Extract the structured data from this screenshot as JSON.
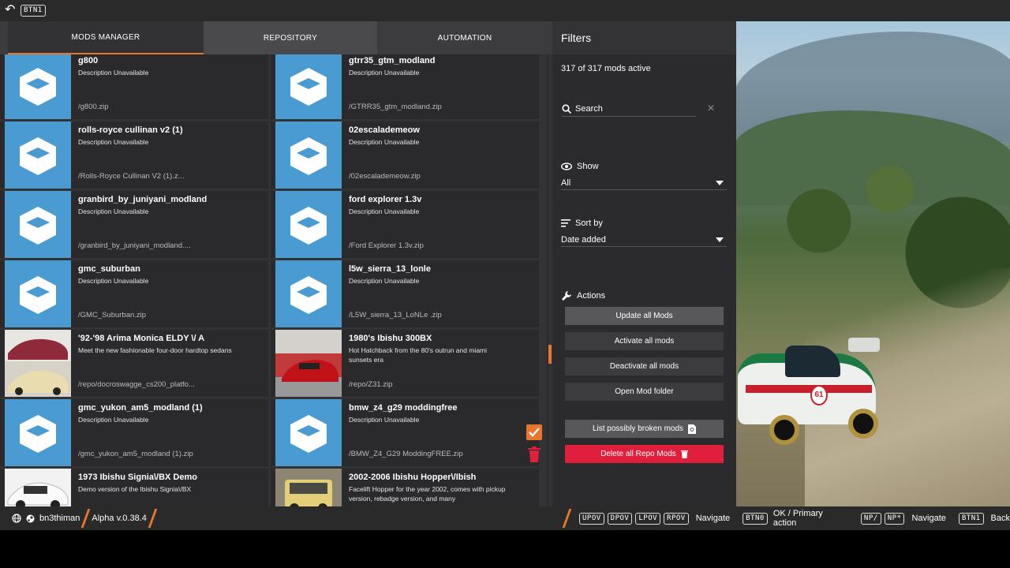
{
  "topbar": {
    "back_key": "BTN1"
  },
  "tabs": [
    {
      "label": "MODS MANAGER",
      "active": true
    },
    {
      "label": "REPOSITORY",
      "active": false
    },
    {
      "label": "AUTOMATION",
      "active": false
    }
  ],
  "mods": [
    {
      "title": "g800",
      "desc": "Description Unavailable",
      "path": "/g800.zip",
      "thumb": "cube"
    },
    {
      "title": "gtrr35_gtm_modland",
      "desc": "Description Unavailable",
      "path": "/GTRR35_gtm_modland.zip",
      "thumb": "cube"
    },
    {
      "title": "rolls-royce cullinan v2 (1)",
      "desc": "Description Unavailable",
      "path": "/Rolls-Royce Cullinan V2 (1).z...",
      "thumb": "cube"
    },
    {
      "title": "02escalademeow",
      "desc": "Description Unavailable",
      "path": "/02escalademeow.zip",
      "thumb": "cube"
    },
    {
      "title": "granbird_by_juniyani_modland",
      "desc": "Description Unavailable",
      "path": "/granbird_by_juniyani_modland....",
      "thumb": "cube"
    },
    {
      "title": "ford explorer 1.3v",
      "desc": "Description Unavailable",
      "path": "/Ford Explorer 1.3v.zip",
      "thumb": "cube"
    },
    {
      "title": "gmc_suburban",
      "desc": "Description Unavailable",
      "path": "/GMC_Suburban.zip",
      "thumb": "cube"
    },
    {
      "title": "l5w_sierra_13_lonle",
      "desc": "Description Unavailable",
      "path": "/L5W_sierra_13_LoNLe .zip",
      "thumb": "cube"
    },
    {
      "title": "'92-'98 Arima Monica ELDY \\/ A",
      "desc": "Meet the new fashionable four-door hardtop sedans",
      "path": "/repo/docroswagge_cs200_platfo...",
      "thumb": "photo-sedan"
    },
    {
      "title": "1980's Ibishu 300BX",
      "desc": "Hot Hatchback from the 80's outrun and miami sunsets era",
      "path": "/repo/Z31.zip",
      "thumb": "photo-red"
    },
    {
      "title": "gmc_yukon_am5_modland (1)",
      "desc": "Description Unavailable",
      "path": "/gmc_yukon_am5_modland (1).zip",
      "thumb": "cube"
    },
    {
      "title": "bmw_z4_g29 moddingfree",
      "desc": "Description Unavailable",
      "path": "/BMW_Z4_G29 ModdingFREE.zip",
      "thumb": "cube"
    },
    {
      "title": "1973 Ibishu Signia\\/BX Demo",
      "desc": "Demo version of the Ibishu Signia\\/BX",
      "path": "",
      "thumb": "photo-white"
    },
    {
      "title": "2002-2006 Ibishu Hopper\\/Ibish",
      "desc": "Facelift Hopper for the year 2002, comes with pickup version, rebadge version, and many",
      "path": "",
      "thumb": "photo-yellow"
    }
  ],
  "filters": {
    "title": "Filters",
    "active_count": "317 of 317 mods active",
    "search_placeholder": "Search",
    "show_label": "Show",
    "show_value": "All",
    "sort_label": "Sort by",
    "sort_value": "Date added",
    "actions_label": "Actions",
    "buttons": {
      "update": "Update all Mods",
      "activate": "Activate all mods",
      "deactivate": "Deactivate all mods",
      "open_folder": "Open Mod folder",
      "broken": "List possibly broken mods",
      "delete_repo": "Delete all Repo Mods"
    }
  },
  "bottombar": {
    "username": "bn3thiman",
    "version": "Alpha v.0.38.4",
    "keys_nav": [
      "UPOV",
      "DPOV",
      "LPOV",
      "RPOV"
    ],
    "navigate_label": "Navigate",
    "ok_key": "BTN0",
    "ok_label": "OK / Primary action",
    "np_keys": [
      "NP/",
      "NP*"
    ],
    "navigate2_label": "Navigate",
    "back_key": "BTN1",
    "back_label": "Back"
  },
  "colors": {
    "accent": "#e8762c",
    "danger": "#e01f3d",
    "thumb_blue": "#4a9bd1"
  }
}
